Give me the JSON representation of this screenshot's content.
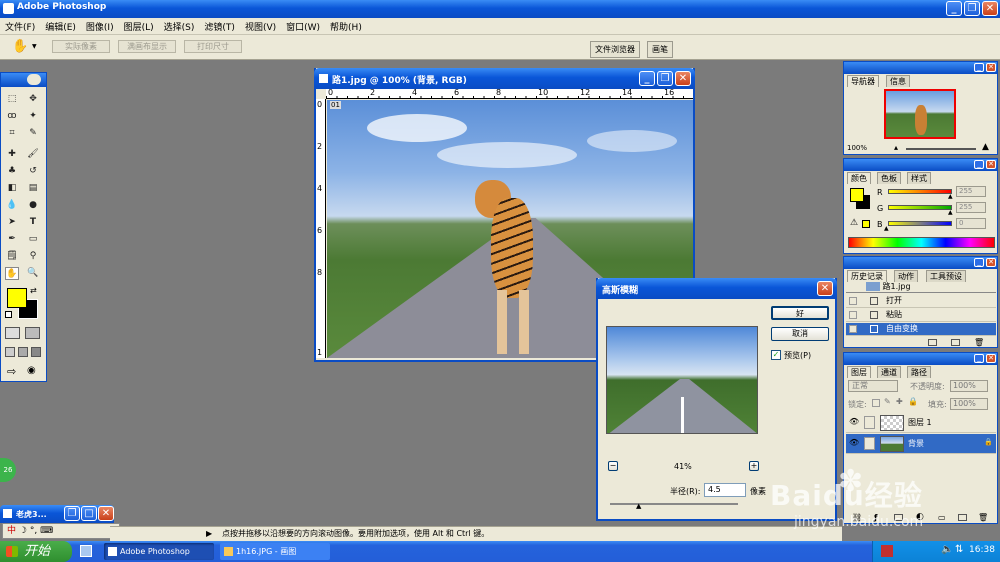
{
  "app": {
    "title": "Adobe Photoshop"
  },
  "menu": [
    "文件(F)",
    "编辑(E)",
    "图像(I)",
    "图层(L)",
    "选择(S)",
    "滤镜(T)",
    "视图(V)",
    "窗口(W)",
    "帮助(H)"
  ],
  "options": {
    "actual_pixels": "实际像素",
    "fit_screen": "满画布显示",
    "print_size": "打印尺寸"
  },
  "palette_well": {
    "file_browser": "文件浏览器",
    "brushes": "画笔"
  },
  "document": {
    "title": "路1.jpg @ 100% (背景, RGB)",
    "ruler_h": [
      "0",
      "2",
      "4",
      "6",
      "8",
      "10",
      "12",
      "14",
      "16"
    ],
    "ruler_v": [
      "0",
      "2",
      "4",
      "6",
      "8",
      "1"
    ],
    "corner_label": "01"
  },
  "navigator": {
    "tabs": [
      "导航器",
      "信息"
    ],
    "zoom": "100%"
  },
  "color": {
    "tabs": [
      "颜色",
      "色板",
      "样式"
    ],
    "channels": [
      {
        "label": "R",
        "value": "255",
        "fraction": 1.0,
        "color": "#ff0000"
      },
      {
        "label": "G",
        "value": "255",
        "fraction": 1.0,
        "color": "#00aa00"
      },
      {
        "label": "B",
        "value": "0",
        "fraction": 0.0,
        "color": "#0000ff"
      }
    ],
    "foreground": "#ffff00"
  },
  "history": {
    "tabs": [
      "历史记录",
      "动作",
      "工具预设"
    ],
    "snapshot": "路1.jpg",
    "items": [
      "打开",
      "粘贴",
      "自由变换"
    ],
    "active_index": 2
  },
  "layers": {
    "tabs": [
      "图层",
      "通道",
      "路径"
    ],
    "blend_mode": "正常",
    "opacity_label": "不透明度:",
    "opacity": "100%",
    "lock_label": "锁定:",
    "fill_label": "填充:",
    "fill": "100%",
    "items": [
      {
        "name": "图层 1",
        "active": false,
        "locked": false
      },
      {
        "name": "背景",
        "active": true,
        "locked": true
      }
    ]
  },
  "dialog": {
    "title": "高斯模糊",
    "ok": "好",
    "cancel": "取消",
    "preview_label": "预览(P)",
    "zoom": "41%",
    "minus": "−",
    "plus": "+",
    "radius_label": "半径(R):",
    "radius": "4.5",
    "unit": "像素"
  },
  "status": {
    "text": "点按并拖移以沿想要的方向滚动图像。要用附加选项，使用 Alt 和 Ctrl 键。",
    "badge": "26"
  },
  "minimized_window": {
    "title": "老虎3..."
  },
  "ime": {
    "label": "中"
  },
  "taskbar": {
    "start": "开始",
    "tasks": [
      "Adobe Photoshop",
      "1h16.JPG - 画图"
    ],
    "time": "16:38"
  },
  "watermark": {
    "text": "Baidu经验",
    "url": "jingyan.baidu.com"
  },
  "colors": {
    "xp_blue": "#0a4cc4",
    "panel_bg": "#ece9d8",
    "workspace": "#7b7b7b",
    "highlight": "#316ac5"
  }
}
